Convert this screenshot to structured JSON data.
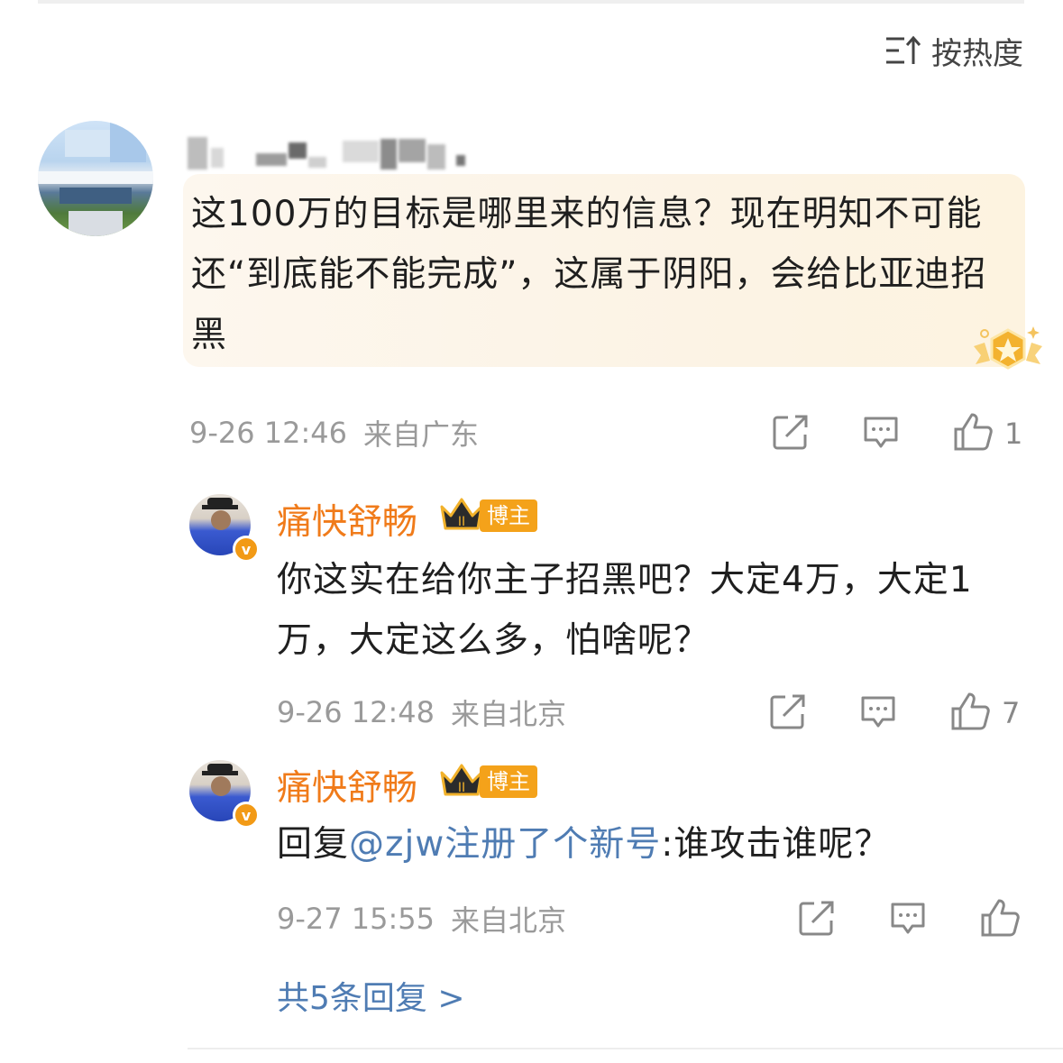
{
  "sort": {
    "label": "按热度"
  },
  "comment": {
    "text": "这100万的目标是哪里来的信息？现在明知不可能还“到底能不能完成”，这属于阴阳，会给比亚迪招黑",
    "time": "9-26 12:46",
    "location": "来自广东",
    "likes": "1"
  },
  "replies": [
    {
      "name": "痛快舒畅",
      "role": "博主",
      "crown_level": "II",
      "text": "你这实在给你主子招黑吧？大定4万，大定1万，大定这么多，怕啥呢？",
      "time": "9-26 12:48",
      "location": "来自北京",
      "likes": "7"
    },
    {
      "name": "痛快舒畅",
      "role": "博主",
      "crown_level": "II",
      "reply_prefix": "回复",
      "mention": "@zjw注册了个新号",
      "text": ":谁攻击谁呢？",
      "time": "9-27 15:55",
      "location": "来自北京",
      "likes": ""
    }
  ],
  "more_replies": "共5条回复 >",
  "colors": {
    "accent_orange": "#f07b1a",
    "link_blue": "#4f7cb3",
    "meta_gray": "#9a9a9a"
  },
  "icons": [
    "sort-icon",
    "share-icon",
    "comment-icon",
    "like-icon",
    "crown-icon",
    "verified-icon",
    "gold-badge-icon"
  ]
}
